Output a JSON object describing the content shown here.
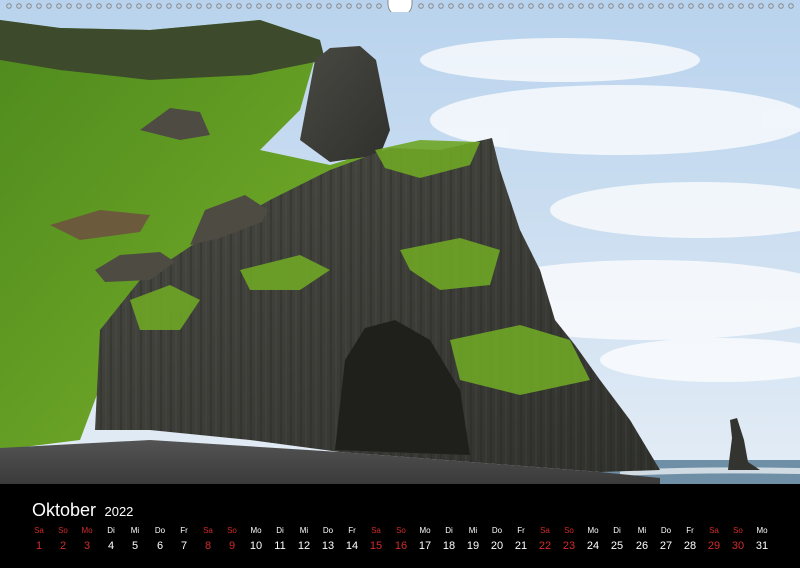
{
  "calendar": {
    "month": "Oktober",
    "year": "2022",
    "days": [
      {
        "weekday": "Sa",
        "date": "1",
        "weekend": true
      },
      {
        "weekday": "So",
        "date": "2",
        "weekend": true
      },
      {
        "weekday": "Mo",
        "date": "3",
        "weekend": true
      },
      {
        "weekday": "Di",
        "date": "4",
        "weekend": false
      },
      {
        "weekday": "Mi",
        "date": "5",
        "weekend": false
      },
      {
        "weekday": "Do",
        "date": "6",
        "weekend": false
      },
      {
        "weekday": "Fr",
        "date": "7",
        "weekend": false
      },
      {
        "weekday": "Sa",
        "date": "8",
        "weekend": true
      },
      {
        "weekday": "So",
        "date": "9",
        "weekend": true
      },
      {
        "weekday": "Mo",
        "date": "10",
        "weekend": false
      },
      {
        "weekday": "Di",
        "date": "11",
        "weekend": false
      },
      {
        "weekday": "Mi",
        "date": "12",
        "weekend": false
      },
      {
        "weekday": "Do",
        "date": "13",
        "weekend": false
      },
      {
        "weekday": "Fr",
        "date": "14",
        "weekend": false
      },
      {
        "weekday": "Sa",
        "date": "15",
        "weekend": true
      },
      {
        "weekday": "So",
        "date": "16",
        "weekend": true
      },
      {
        "weekday": "Mo",
        "date": "17",
        "weekend": false
      },
      {
        "weekday": "Di",
        "date": "18",
        "weekend": false
      },
      {
        "weekday": "Mi",
        "date": "19",
        "weekend": false
      },
      {
        "weekday": "Do",
        "date": "20",
        "weekend": false
      },
      {
        "weekday": "Fr",
        "date": "21",
        "weekend": false
      },
      {
        "weekday": "Sa",
        "date": "22",
        "weekend": true
      },
      {
        "weekday": "So",
        "date": "23",
        "weekend": true
      },
      {
        "weekday": "Mo",
        "date": "24",
        "weekend": false
      },
      {
        "weekday": "Di",
        "date": "25",
        "weekend": false
      },
      {
        "weekday": "Mi",
        "date": "26",
        "weekend": false
      },
      {
        "weekday": "Do",
        "date": "27",
        "weekend": false
      },
      {
        "weekday": "Fr",
        "date": "28",
        "weekend": false
      },
      {
        "weekday": "Sa",
        "date": "29",
        "weekend": true
      },
      {
        "weekday": "So",
        "date": "30",
        "weekend": true
      },
      {
        "weekday": "Mo",
        "date": "31",
        "weekend": false
      }
    ]
  },
  "colors": {
    "background": "#000000",
    "text": "#ffffff",
    "weekend": "#d22b2b"
  },
  "photo": {
    "subject": "basalt-column-cliff-with-sea-stack"
  }
}
